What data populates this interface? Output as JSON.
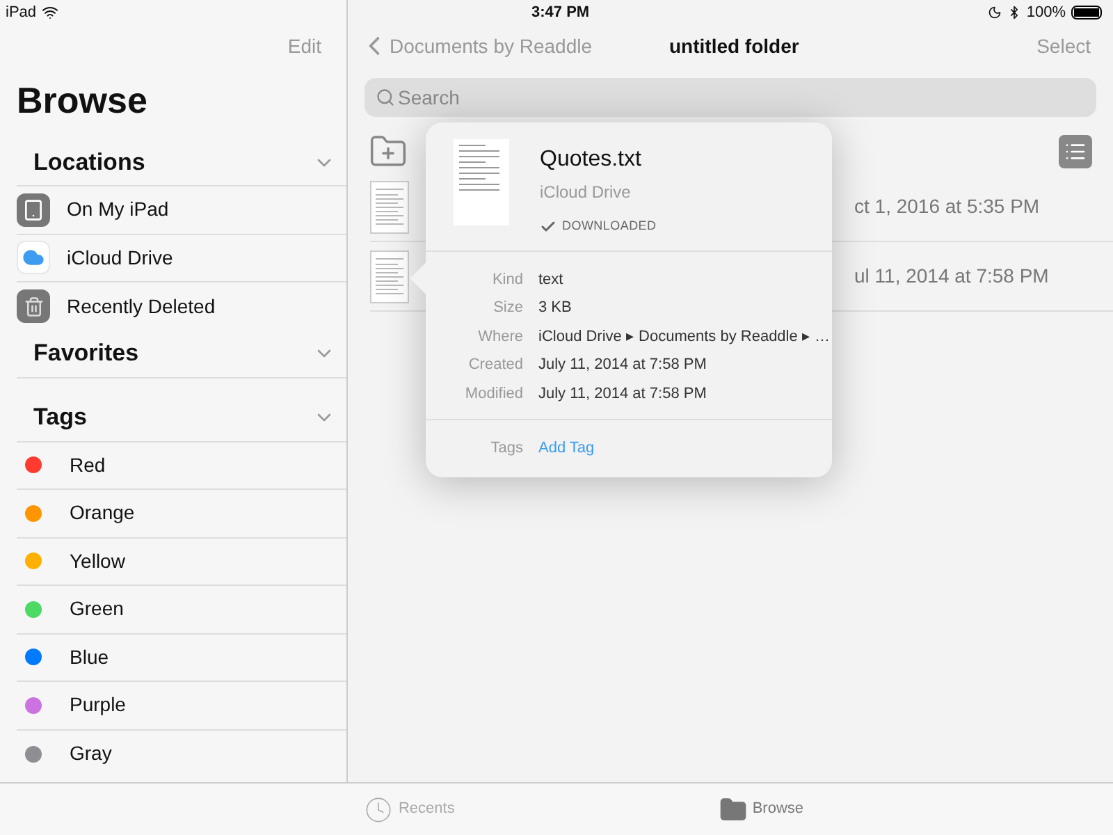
{
  "status_bar": {
    "device": "iPad",
    "time": "3:47 PM",
    "battery": "100%"
  },
  "sidebar": {
    "edit": "Edit",
    "title": "Browse",
    "sections": [
      {
        "title": "Locations",
        "expanded": true,
        "items": [
          {
            "label": "On My iPad",
            "kind": "ipad"
          },
          {
            "label": "iCloud Drive",
            "kind": "cloud"
          },
          {
            "label": "Recently Deleted",
            "kind": "trash"
          }
        ]
      },
      {
        "title": "Favorites",
        "expanded": true
      },
      {
        "title": "Tags",
        "expanded": true,
        "items": [
          {
            "label": "Red",
            "kind": "tag",
            "color": "#ff3b30"
          },
          {
            "label": "Orange",
            "kind": "tag",
            "color": "#ff9500"
          },
          {
            "label": "Yellow",
            "kind": "tag",
            "color": "#ffb000"
          },
          {
            "label": "Green",
            "kind": "tag",
            "color": "#4cd964"
          },
          {
            "label": "Blue",
            "kind": "tag",
            "color": "#007aff"
          },
          {
            "label": "Purple",
            "kind": "tag",
            "color": "#cc73e1"
          },
          {
            "label": "Gray",
            "kind": "tag",
            "color": "#8e8e93"
          }
        ]
      }
    ]
  },
  "nav": {
    "back": "Documents by Readdle",
    "title": "untitled folder",
    "select": "Select"
  },
  "search": {
    "placeholder": "Search"
  },
  "files": [
    {
      "date": "ct 1, 2016 at 5:35 PM"
    },
    {
      "date": "ul 11, 2014 at 7:58 PM"
    }
  ],
  "popover": {
    "name": "Quotes.txt",
    "location": "iCloud Drive",
    "status": "DOWNLOADED",
    "details": [
      {
        "label": "Kind",
        "value": "text"
      },
      {
        "label": "Size",
        "value": "3 KB"
      },
      {
        "label": "Where",
        "value": "iCloud Drive ▸ Documents by Readdle ▸ …"
      },
      {
        "label": "Created",
        "value": "July 11, 2014 at 7:58 PM"
      },
      {
        "label": "Modified",
        "value": "July 11, 2014 at 7:58 PM"
      }
    ],
    "tags_label": "Tags",
    "add_tag": "Add Tag"
  },
  "tab_bar": [
    {
      "label": "Recents",
      "kind": "clock",
      "selected": false
    },
    {
      "label": "Browse",
      "kind": "folder",
      "selected": true
    }
  ]
}
